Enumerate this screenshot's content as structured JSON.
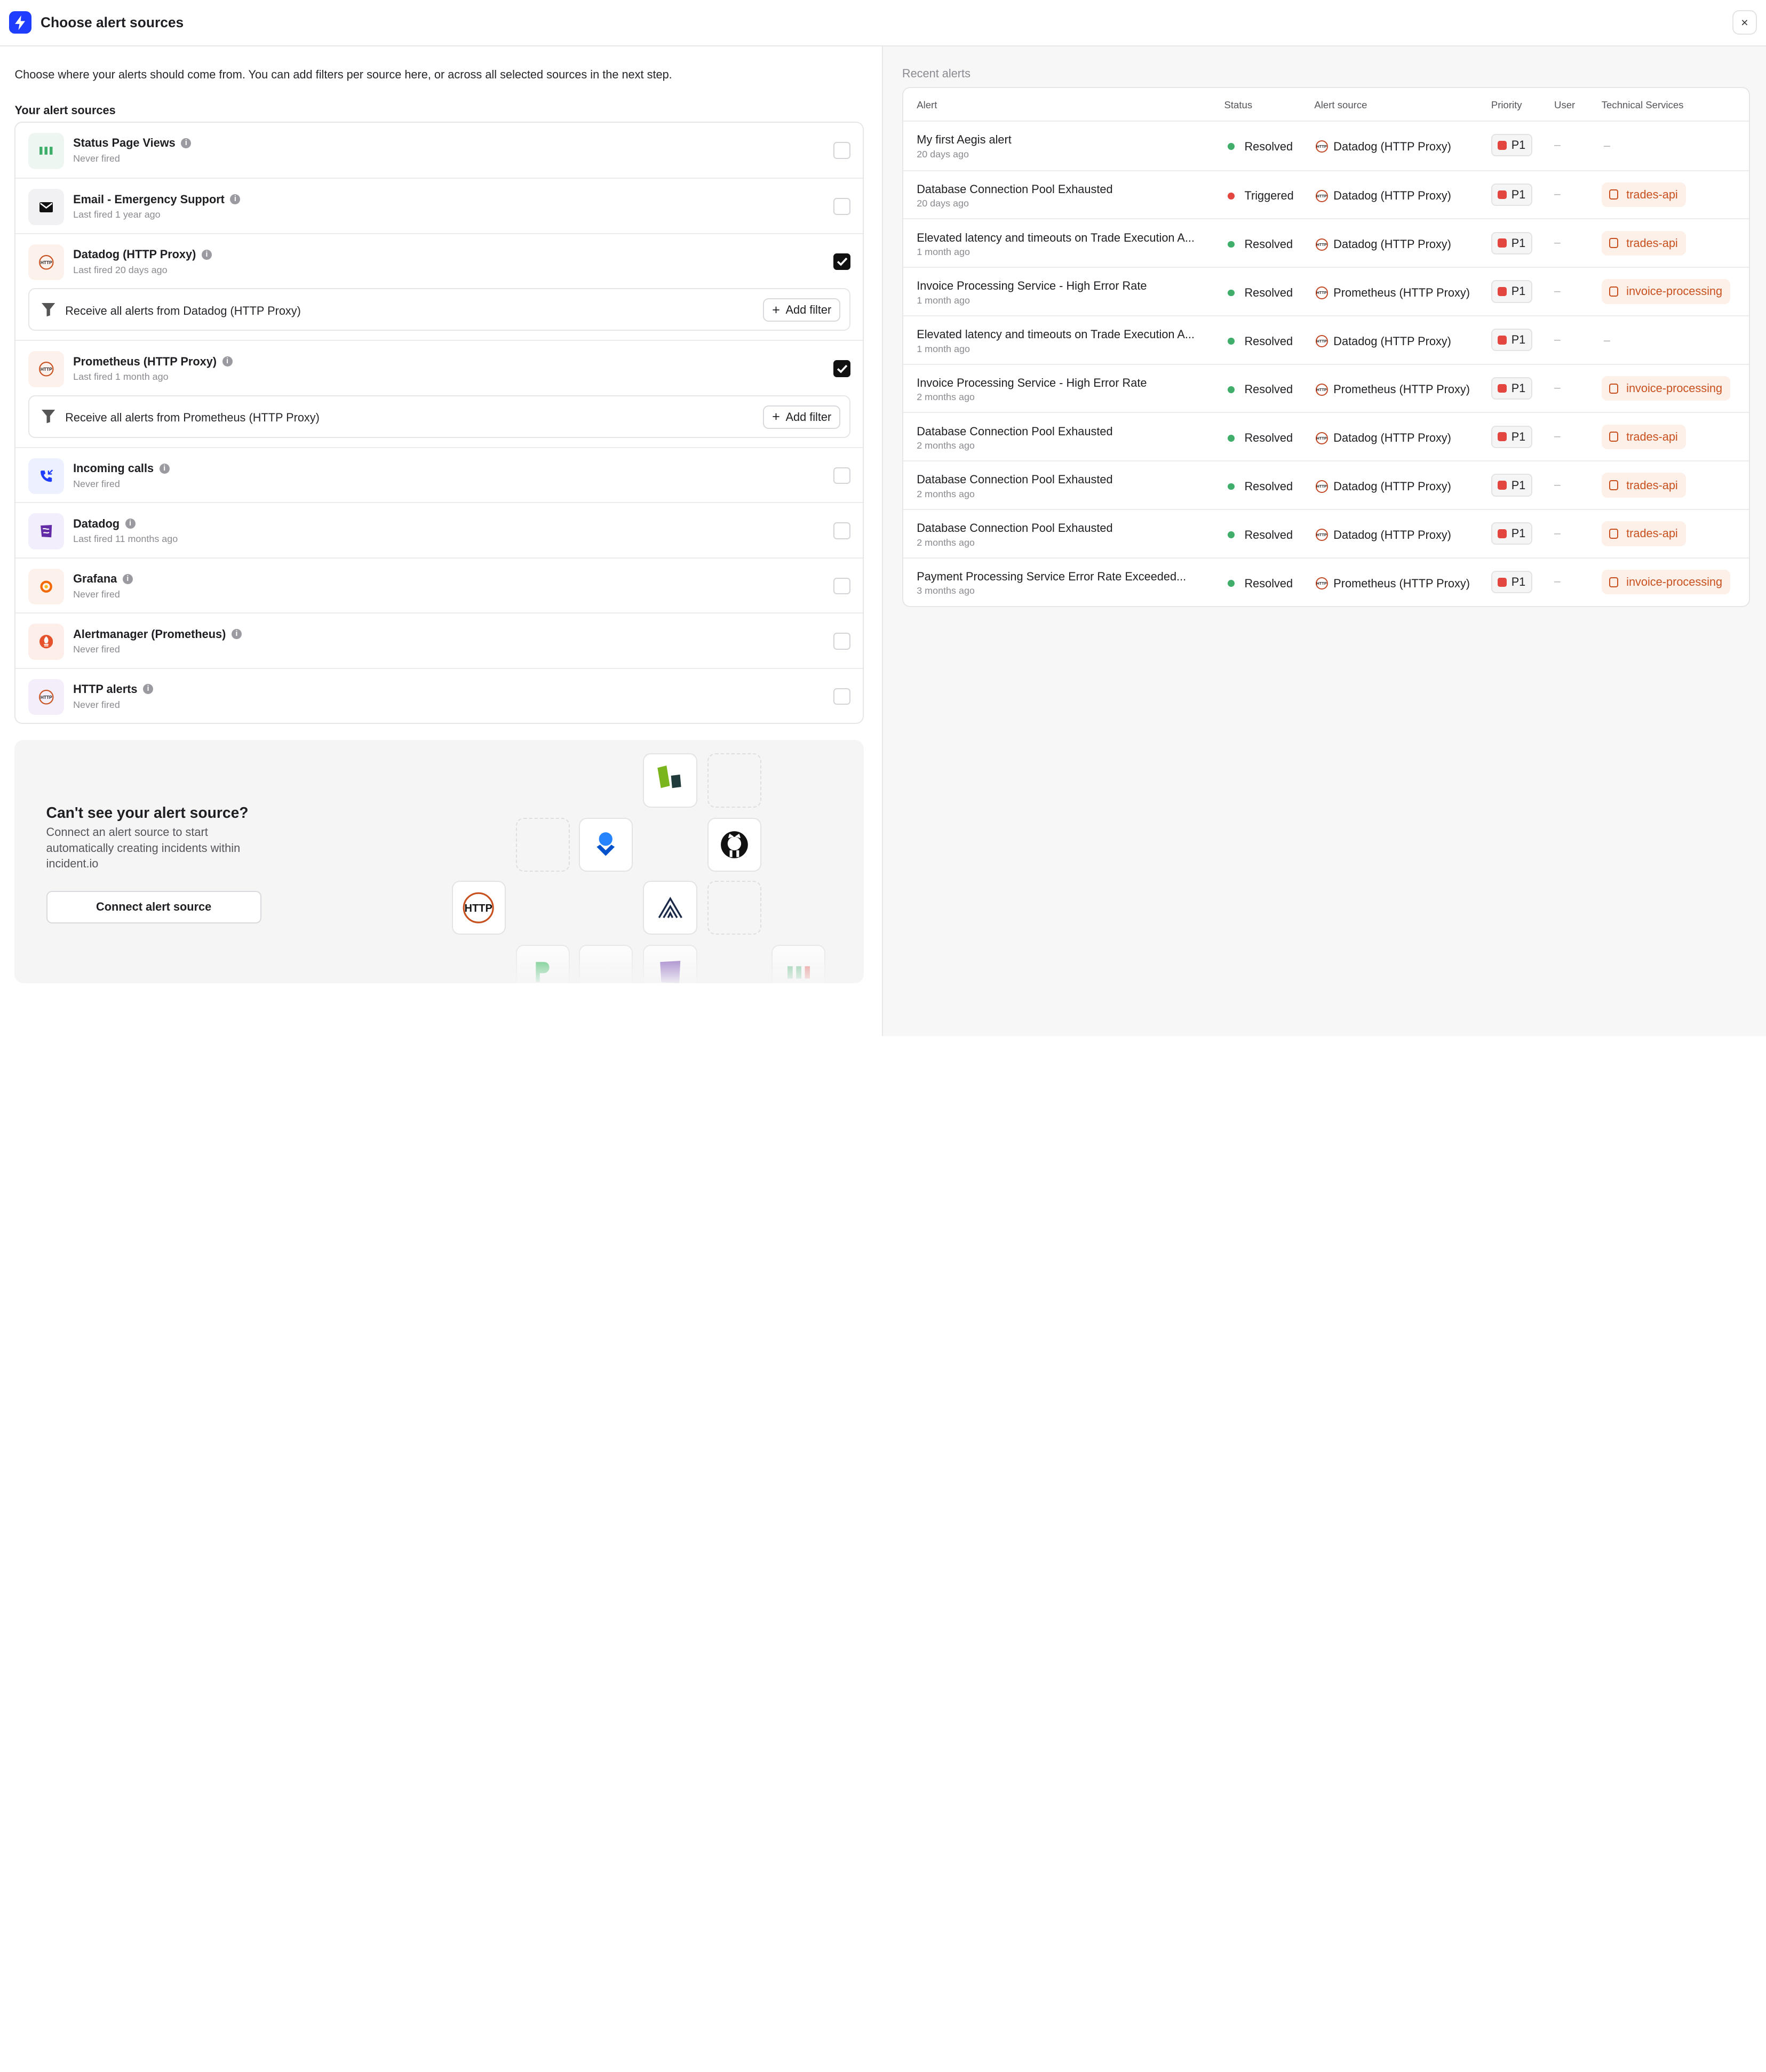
{
  "header": {
    "title": "Choose alert sources",
    "close_label": "×"
  },
  "intro": "Choose where your alerts should come from. You can add filters per source here, or across all selected sources in the next step.",
  "section_label": "Your alert sources",
  "sources": [
    {
      "name": "Status Page Views",
      "sub": "Never fired",
      "checked": false,
      "icon": "status-page-icon"
    },
    {
      "name": "Email - Emergency Support",
      "sub": "Last fired 1 year ago",
      "checked": false,
      "icon": "email-icon"
    },
    {
      "name": "Datadog (HTTP Proxy)",
      "sub": "Last fired 20 days ago",
      "checked": true,
      "icon": "http-icon",
      "filter": "Receive all alerts from Datadog (HTTP Proxy)"
    },
    {
      "name": "Prometheus (HTTP Proxy)",
      "sub": "Last fired 1 month ago",
      "checked": true,
      "icon": "http-icon",
      "filter": "Receive all alerts from Prometheus (HTTP Proxy)"
    },
    {
      "name": "Incoming calls",
      "sub": "Never fired",
      "checked": false,
      "icon": "phone-icon"
    },
    {
      "name": "Datadog",
      "sub": "Last fired 11 months ago",
      "checked": false,
      "icon": "datadog-icon"
    },
    {
      "name": "Grafana",
      "sub": "Never fired",
      "checked": false,
      "icon": "grafana-icon"
    },
    {
      "name": "Alertmanager (Prometheus)",
      "sub": "Never fired",
      "checked": false,
      "icon": "prometheus-icon"
    },
    {
      "name": "HTTP alerts",
      "sub": "Never fired",
      "checked": false,
      "icon": "http-icon"
    }
  ],
  "add_filter_label": "Add filter",
  "cta": {
    "title": "Can't see your alert source?",
    "desc": "Connect an alert source to start automatically creating incidents within incident.io",
    "button": "Connect alert source",
    "http_tile_text": "HTTP"
  },
  "recent": {
    "label": "Recent alerts",
    "columns": [
      "Alert",
      "Status",
      "Alert source",
      "Priority",
      "User",
      "Technical Services"
    ],
    "empty_dash": "–",
    "rows": [
      {
        "alert": "My first Aegis alert",
        "ago": "20 days ago",
        "status": "Resolved",
        "source": "Datadog (HTTP Proxy)",
        "priority": "P1",
        "user": "–",
        "service": ""
      },
      {
        "alert": "Database Connection Pool Exhausted",
        "ago": "20 days ago",
        "status": "Triggered",
        "source": "Datadog (HTTP Proxy)",
        "priority": "P1",
        "user": "–",
        "service": "trades-api"
      },
      {
        "alert": "Elevated latency and timeouts on Trade Execution A...",
        "ago": "1 month ago",
        "status": "Resolved",
        "source": "Datadog (HTTP Proxy)",
        "priority": "P1",
        "user": "–",
        "service": "trades-api"
      },
      {
        "alert": "Invoice Processing Service - High Error Rate",
        "ago": "1 month ago",
        "status": "Resolved",
        "source": "Prometheus (HTTP Proxy)",
        "priority": "P1",
        "user": "–",
        "service": "invoice-processing"
      },
      {
        "alert": "Elevated latency and timeouts on Trade Execution A...",
        "ago": "1 month ago",
        "status": "Resolved",
        "source": "Datadog (HTTP Proxy)",
        "priority": "P1",
        "user": "–",
        "service": ""
      },
      {
        "alert": "Invoice Processing Service - High Error Rate",
        "ago": "2 months ago",
        "status": "Resolved",
        "source": "Prometheus (HTTP Proxy)",
        "priority": "P1",
        "user": "–",
        "service": "invoice-processing"
      },
      {
        "alert": "Database Connection Pool Exhausted",
        "ago": "2 months ago",
        "status": "Resolved",
        "source": "Datadog (HTTP Proxy)",
        "priority": "P1",
        "user": "–",
        "service": "trades-api"
      },
      {
        "alert": "Database Connection Pool Exhausted",
        "ago": "2 months ago",
        "status": "Resolved",
        "source": "Datadog (HTTP Proxy)",
        "priority": "P1",
        "user": "–",
        "service": "trades-api"
      },
      {
        "alert": "Database Connection Pool Exhausted",
        "ago": "2 months ago",
        "status": "Resolved",
        "source": "Datadog (HTTP Proxy)",
        "priority": "P1",
        "user": "–",
        "service": "trades-api"
      },
      {
        "alert": "Payment Processing Service Error Rate Exceeded...",
        "ago": "3 months ago",
        "status": "Resolved",
        "source": "Prometheus (HTTP Proxy)",
        "priority": "P1",
        "user": "–",
        "service": "invoice-processing"
      }
    ]
  },
  "colors": {
    "brand": "#1f3dff",
    "resolved": "#3fae6a",
    "triggered": "#e2463f",
    "service_bg": "#fdf0e8",
    "service_text": "#c8501e"
  }
}
